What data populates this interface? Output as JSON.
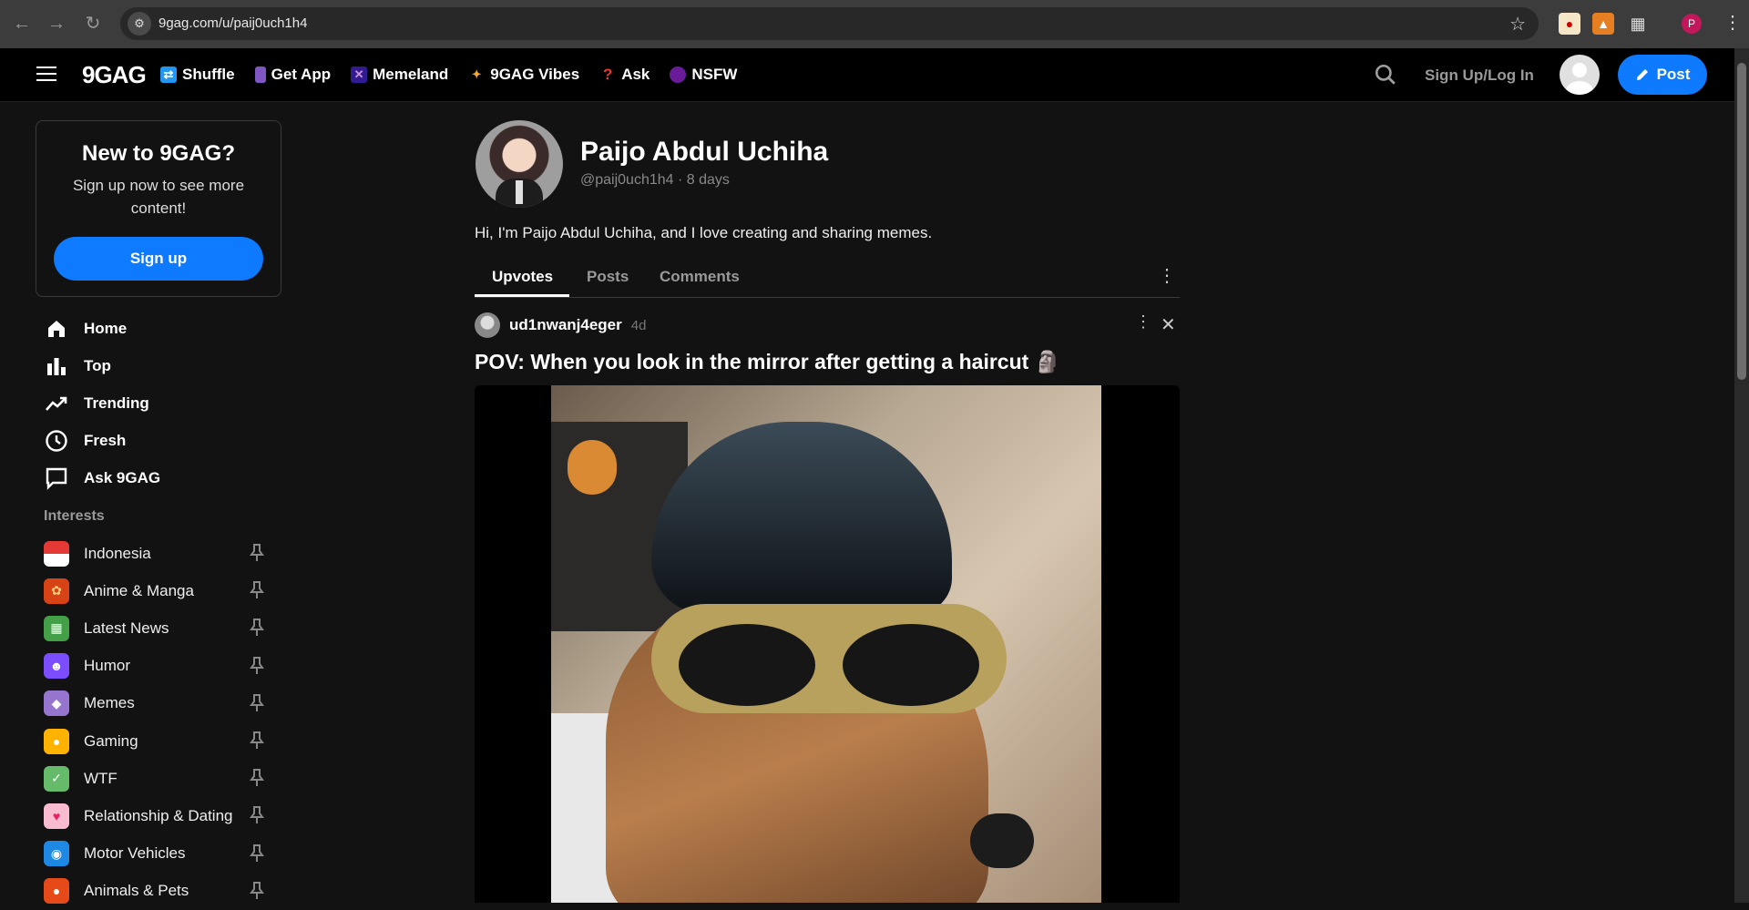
{
  "browser": {
    "url": "9gag.com/u/paij0uch1h4",
    "profile_initial": "P"
  },
  "header": {
    "logo": "9GAG",
    "nav": [
      {
        "label": "Shuffle",
        "icon": "shuffle-icon",
        "color": "#2196f3"
      },
      {
        "label": "Get App",
        "icon": "phone-icon",
        "color": "#7e57c2"
      },
      {
        "label": "Memeland",
        "icon": "memeland-icon",
        "color": "#5e35b1"
      },
      {
        "label": "9GAG Vibes",
        "icon": "comet-icon",
        "color": "#f9a825"
      },
      {
        "label": "Ask",
        "icon": "question-icon",
        "color": "#e53935"
      },
      {
        "label": "NSFW",
        "icon": "bomb-icon",
        "color": "#8e24aa"
      }
    ],
    "login_label": "Sign Up/Log In",
    "post_label": "Post",
    "accent": "#0e7aff"
  },
  "sidebar": {
    "signup_card": {
      "title": "New to 9GAG?",
      "text": "Sign up now to see more content!",
      "button": "Sign up"
    },
    "main_nav": [
      {
        "label": "Home",
        "icon": "home-icon"
      },
      {
        "label": "Top",
        "icon": "bar-chart-icon"
      },
      {
        "label": "Trending",
        "icon": "trending-icon"
      },
      {
        "label": "Fresh",
        "icon": "clock-icon"
      },
      {
        "label": "Ask 9GAG",
        "icon": "comment-icon"
      }
    ],
    "interests_title": "Interests",
    "interests": [
      {
        "label": "Indonesia",
        "icon": "indonesia-flag-icon",
        "color": "#e53935"
      },
      {
        "label": "Anime & Manga",
        "icon": "anime-icon",
        "color": "#d84315"
      },
      {
        "label": "Latest News",
        "icon": "news-icon",
        "color": "#43a047"
      },
      {
        "label": "Humor",
        "icon": "humor-icon",
        "color": "#7c4dff"
      },
      {
        "label": "Memes",
        "icon": "diamond-icon",
        "color": "#9575cd"
      },
      {
        "label": "Gaming",
        "icon": "gamepad-icon",
        "color": "#ffb300"
      },
      {
        "label": "WTF",
        "icon": "wtf-icon",
        "color": "#66bb6a"
      },
      {
        "label": "Relationship & Dating",
        "icon": "heart-icon",
        "color": "#f48fb1"
      },
      {
        "label": "Motor Vehicles",
        "icon": "motorbike-icon",
        "color": "#1e88e5"
      },
      {
        "label": "Animals & Pets",
        "icon": "paw-icon",
        "color": "#e64a19"
      }
    ]
  },
  "profile": {
    "name": "Paijo Abdul Uchiha",
    "meta": "@paij0uch1h4 · 8 days",
    "bio": "Hi, I'm Paijo Abdul Uchiha, and I love creating and sharing memes.",
    "tabs": [
      "Upvotes",
      "Posts",
      "Comments"
    ],
    "active_tab": "Upvotes"
  },
  "post": {
    "username": "ud1nwanj4eger",
    "age": "4d",
    "title": "POV: When you look in the mirror after getting a haircut 🗿"
  }
}
